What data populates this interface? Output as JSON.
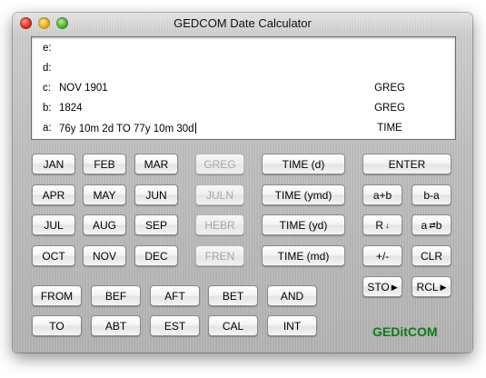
{
  "window": {
    "title": "GEDCOM Date Calculator"
  },
  "display": {
    "registers": [
      {
        "label": "e:",
        "value": "",
        "calendar": ""
      },
      {
        "label": "d:",
        "value": "",
        "calendar": ""
      },
      {
        "label": "c:",
        "value": "NOV 1901",
        "calendar": "GREG"
      },
      {
        "label": "b:",
        "value": "1824",
        "calendar": "GREG"
      },
      {
        "label": "a:",
        "value": "76y 10m 2d TO 77y 10m 30d",
        "calendar": "TIME"
      }
    ]
  },
  "months": {
    "jan": "JAN",
    "feb": "FEB",
    "mar": "MAR",
    "apr": "APR",
    "may": "MAY",
    "jun": "JUN",
    "jul": "JUL",
    "aug": "AUG",
    "sep": "SEP",
    "oct": "OCT",
    "nov": "NOV",
    "dec": "DEC"
  },
  "calendars": {
    "greg": "GREG",
    "juln": "JULN",
    "hebr": "HEBR",
    "fren": "FREN"
  },
  "time": {
    "d": "TIME (d)",
    "ymd": "TIME (ymd)",
    "yd": "TIME (yd)",
    "md": "TIME (md)"
  },
  "ops": {
    "enter": "ENTER",
    "add": "a+b",
    "sub": "b-a",
    "roll": "R",
    "swap": "a",
    "negate": "+/-",
    "clear": "CLR",
    "store": "STO",
    "recall": "RCL"
  },
  "modifiers": {
    "from": "FROM",
    "bef": "BEF",
    "aft": "AFT",
    "bet": "BET",
    "and": "AND",
    "to": "TO",
    "abt": "ABT",
    "est": "EST",
    "cal": "CAL",
    "int": "INT"
  },
  "brand": "GEDitCOM",
  "icons": {
    "roll": "down-arrow-icon",
    "swap": "swap-arrows-icon",
    "store": "right-triangle-icon",
    "recall": "right-triangle-icon"
  }
}
